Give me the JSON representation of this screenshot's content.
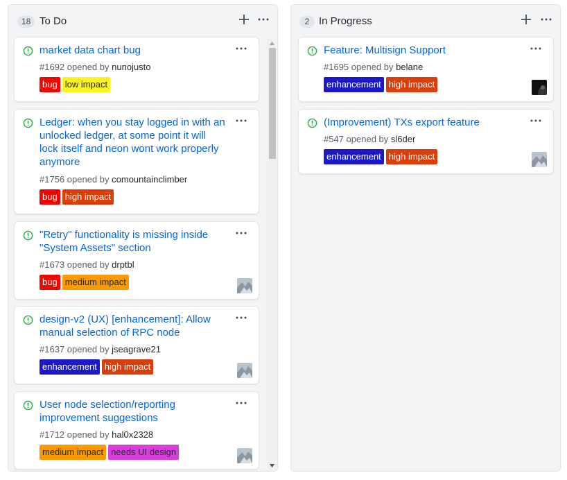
{
  "columns": {
    "todo": {
      "count": "18",
      "title": "To Do",
      "cards": [
        {
          "title": "market data chart bug",
          "number": "#1692",
          "opened_by": "opened by",
          "user": "nunojusto",
          "labels": [
            {
              "text": "bug",
              "bg": "#ee0701",
              "fg": "#ffffff"
            },
            {
              "text": "low impact",
              "bg": "#f9f322",
              "fg": "#24292e"
            }
          ]
        },
        {
          "title": "Ledger: when you stay logged in with an unlocked ledger, at some point it will lock itself and neon wont work properly anymore",
          "number": "#1756",
          "opened_by": "opened by",
          "user": "comountainclimber",
          "labels": [
            {
              "text": "bug",
              "bg": "#ee0701",
              "fg": "#ffffff"
            },
            {
              "text": "high impact",
              "bg": "#d93f0b",
              "fg": "#ffffff"
            }
          ]
        },
        {
          "title": "\"Retry\" functionality is missing inside \"System Assets\" section",
          "number": "#1673",
          "opened_by": "opened by",
          "user": "drptbl",
          "labels": [
            {
              "text": "bug",
              "bg": "#ee0701",
              "fg": "#ffffff"
            },
            {
              "text": "medium impact",
              "bg": "#fb9a00",
              "fg": "#24292e"
            }
          ]
        },
        {
          "title": "design-v2 (UX) [enhancement]: Allow manual selection of RPC node",
          "number": "#1637",
          "opened_by": "opened by",
          "user": "jseagrave21",
          "labels": [
            {
              "text": "enhancement",
              "bg": "#1d18c8",
              "fg": "#ffffff"
            },
            {
              "text": "high impact",
              "bg": "#d93f0b",
              "fg": "#ffffff"
            }
          ]
        },
        {
          "title": "User node selection/reporting improvement suggestions",
          "number": "#1712",
          "opened_by": "opened by",
          "user": "hal0x2328",
          "labels": [
            {
              "text": "medium impact",
              "bg": "#fb9a00",
              "fg": "#24292e"
            },
            {
              "text": "needs UI design",
              "bg": "#d93fdc",
              "fg": "#24292e"
            }
          ]
        }
      ]
    },
    "in_progress": {
      "count": "2",
      "title": "In Progress",
      "cards": [
        {
          "title": "Feature: Multisign Support",
          "number": "#1695",
          "opened_by": "opened by",
          "user": "belane",
          "labels": [
            {
              "text": "enhancement",
              "bg": "#1d18c8",
              "fg": "#ffffff"
            },
            {
              "text": "high impact",
              "bg": "#d93f0b",
              "fg": "#ffffff"
            }
          ]
        },
        {
          "title": "(Improvement) TXs export feature",
          "number": "#547",
          "opened_by": "opened by",
          "user": "sl6der",
          "labels": [
            {
              "text": "enhancement",
              "bg": "#1d18c8",
              "fg": "#ffffff"
            },
            {
              "text": "high impact",
              "bg": "#d93f0b",
              "fg": "#ffffff"
            }
          ]
        }
      ]
    }
  },
  "icons": {
    "add": "plus-icon",
    "menu": "kebab-horizontal-icon",
    "issue_open": "issue-opened-icon",
    "avatar": "user-avatar"
  },
  "colors": {
    "link": "#0366d6",
    "issue_open": "#28a745",
    "column_bg": "#f3f4f6"
  }
}
